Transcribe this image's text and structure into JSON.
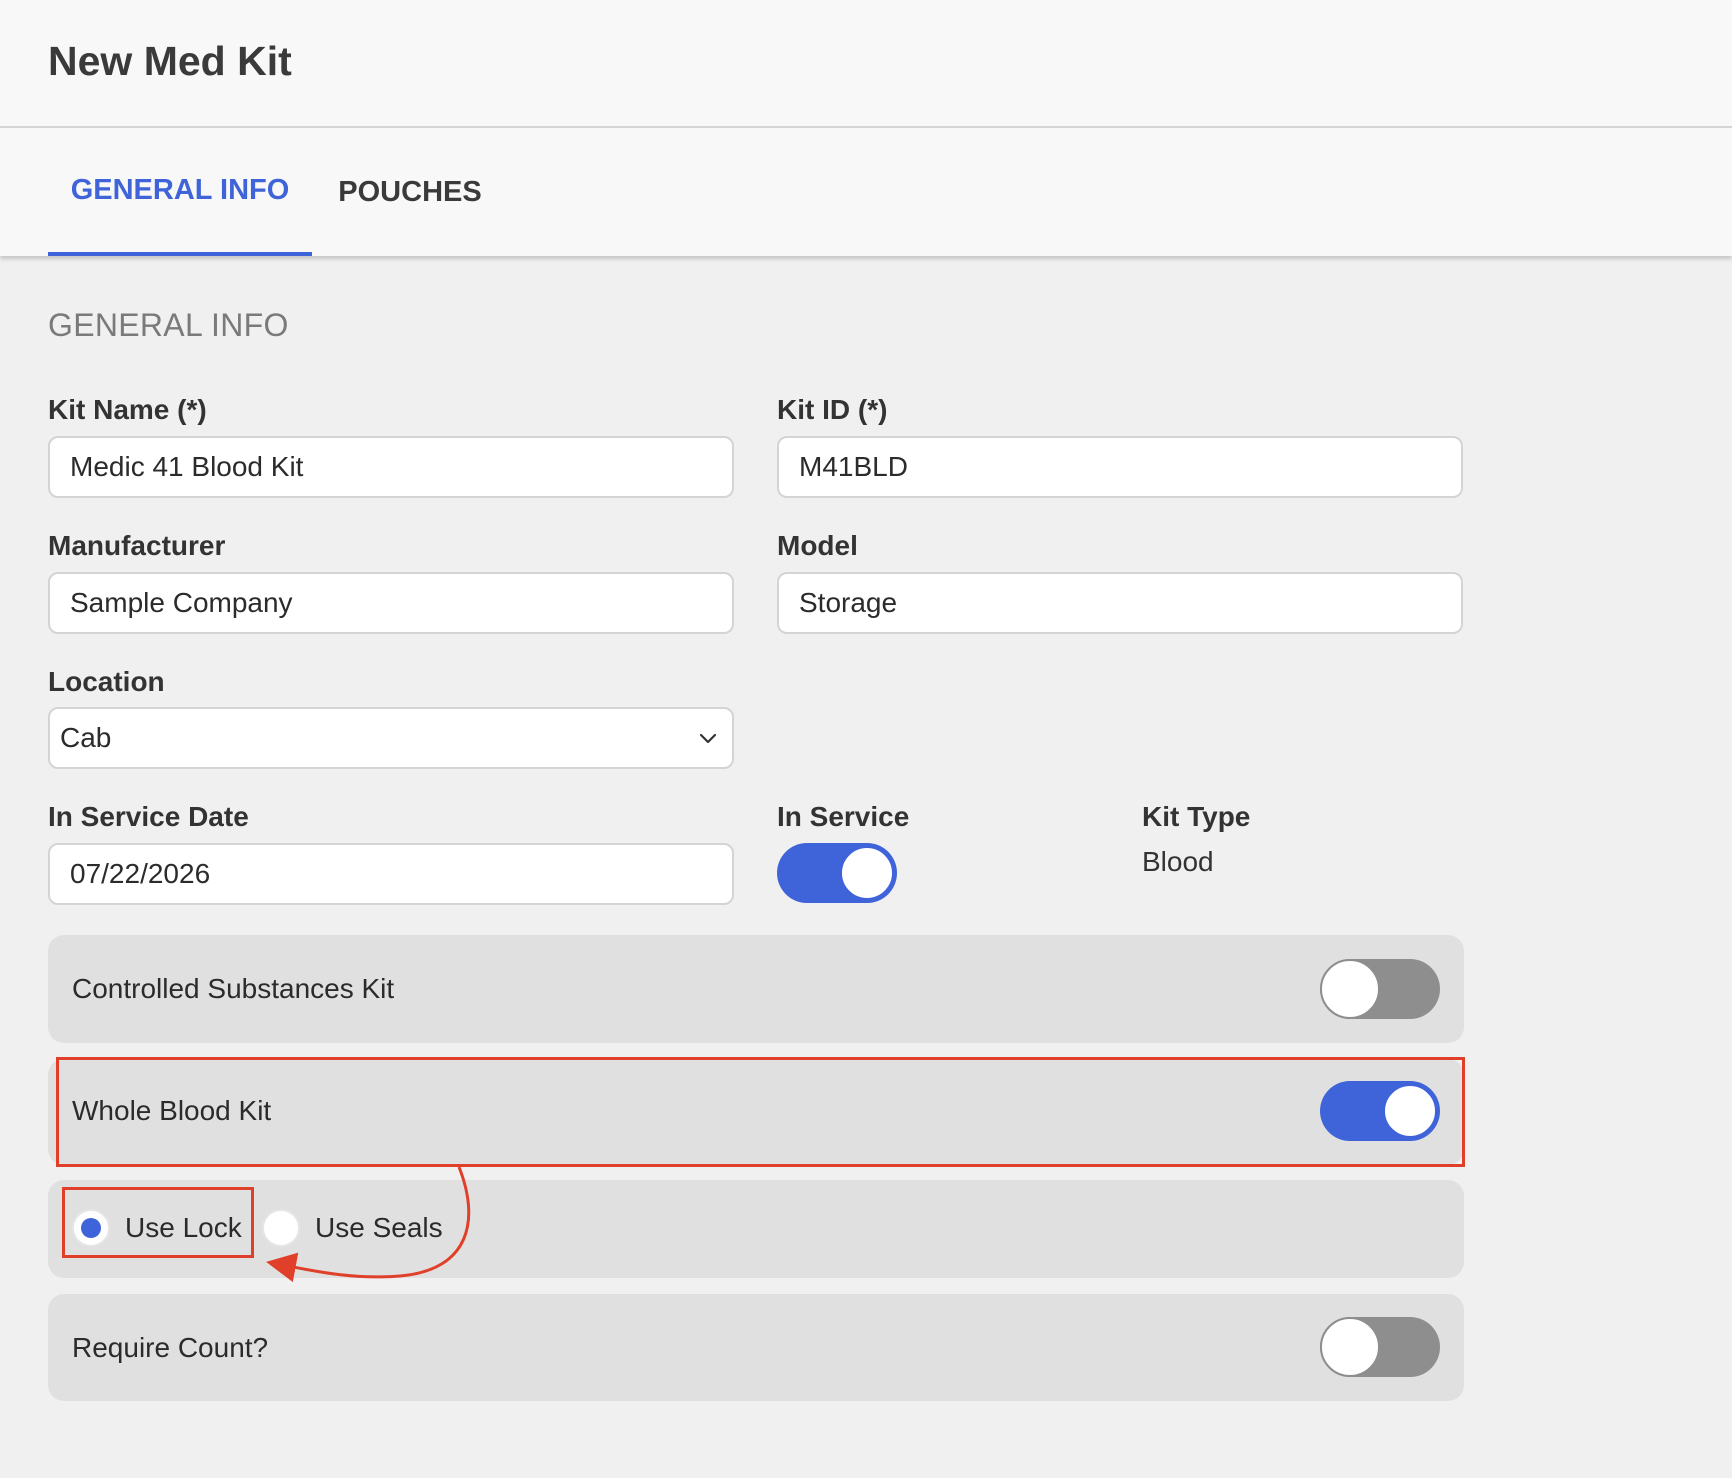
{
  "page": {
    "title": "New Med Kit"
  },
  "tabs": [
    {
      "label": "GENERAL INFO",
      "active": true
    },
    {
      "label": "POUCHES",
      "active": false
    }
  ],
  "section": {
    "title": "GENERAL INFO"
  },
  "fields": {
    "kit_name": {
      "label": "Kit Name (*)",
      "value": "Medic 41 Blood Kit"
    },
    "kit_id": {
      "label": "Kit ID (*)",
      "value": "M41BLD"
    },
    "manufacturer": {
      "label": "Manufacturer",
      "value": "Sample Company"
    },
    "model": {
      "label": "Model",
      "value": "Storage"
    },
    "location": {
      "label": "Location",
      "value": "Cab"
    },
    "in_service_date": {
      "label": "In Service Date",
      "value": "07/22/2026"
    },
    "in_service": {
      "label": "In Service",
      "on": true
    },
    "kit_type": {
      "label": "Kit Type",
      "value": "Blood"
    }
  },
  "options": {
    "controlled_substances": {
      "label": "Controlled Substances Kit",
      "on": false
    },
    "whole_blood": {
      "label": "Whole Blood Kit",
      "on": true
    },
    "use_lock": {
      "label": "Use Lock",
      "selected": true
    },
    "use_seals": {
      "label": "Use Seals",
      "selected": false
    },
    "require_count": {
      "label": "Require Count?",
      "on": false
    }
  },
  "colors": {
    "accent": "#3f63d9",
    "annotation": "#e0402a",
    "toggle_off": "#8e8e8e"
  },
  "icons": {
    "location_dropdown": "chevron-down-icon"
  }
}
